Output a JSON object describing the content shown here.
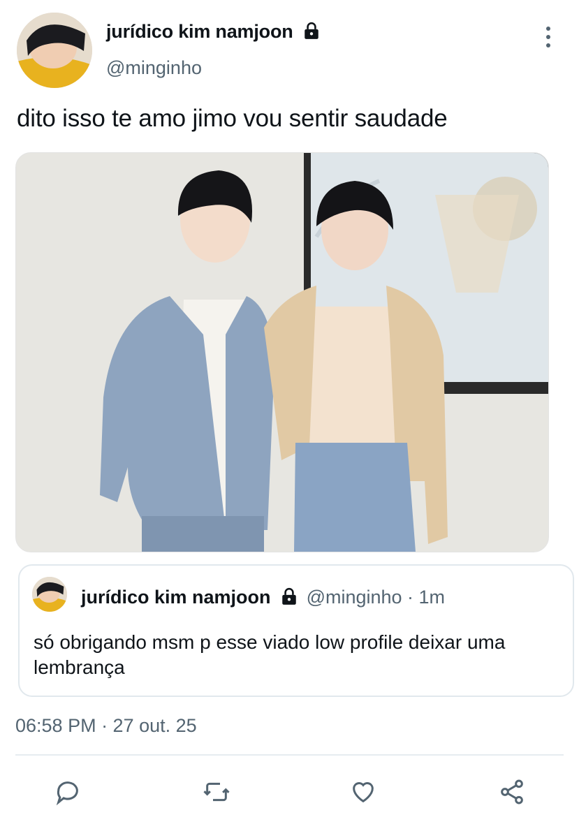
{
  "tweet": {
    "display_name": "jurídico kim namjoon",
    "handle": "@minginho",
    "text": "dito isso te amo jimo vou sentir saudade",
    "timestamp": "06:58 PM · 27 out. 25"
  },
  "quote": {
    "display_name": "jurídico kim namjoon",
    "meta": "@minginho · 1m",
    "text": "só obrigando msm p esse viado low profile deixar uma lembrança"
  },
  "icons": {
    "lock": "lock-icon",
    "more": "more-vertical-icon",
    "reply": "reply-icon",
    "retweet": "retweet-icon",
    "like": "like-icon",
    "share": "share-icon"
  },
  "colors": {
    "text": "#0f1419",
    "secondary": "#536471",
    "border": "#e1e8ed"
  }
}
